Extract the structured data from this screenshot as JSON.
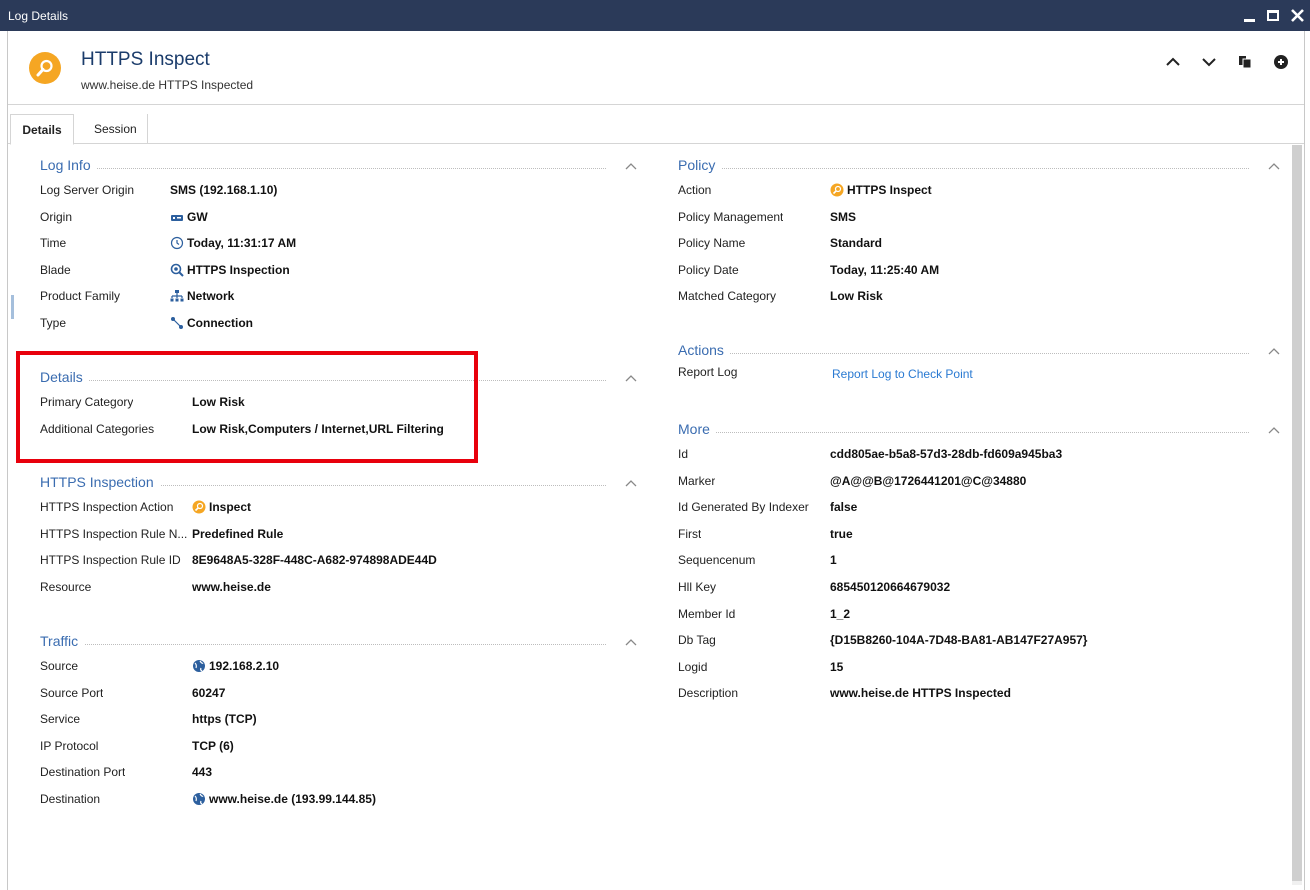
{
  "window": {
    "title": "Log Details"
  },
  "header": {
    "title": "HTTPS Inspect",
    "subtitle": "www.heise.de HTTPS Inspected"
  },
  "tabs": [
    {
      "label": "Details"
    },
    {
      "label": "Session"
    }
  ],
  "left": {
    "log_info": {
      "title": "Log Info",
      "rows": [
        {
          "label": "Log Server Origin",
          "value": "SMS (192.168.1.10)"
        },
        {
          "label": "Origin",
          "value": "GW",
          "icon": "gateway-icon"
        },
        {
          "label": "Time",
          "value": "Today, 11:31:17 AM",
          "icon": "clock-icon"
        },
        {
          "label": "Blade",
          "value": "HTTPS Inspection",
          "icon": "https-inspection-icon"
        },
        {
          "label": "Product Family",
          "value": "Network",
          "icon": "network-icon"
        },
        {
          "label": "Type",
          "value": "Connection",
          "icon": "connection-icon"
        }
      ]
    },
    "details": {
      "title": "Details",
      "rows": [
        {
          "label": "Primary Category",
          "value": "Low Risk"
        },
        {
          "label": "Additional Categories",
          "value": "Low Risk,Computers / Internet,URL Filtering"
        }
      ]
    },
    "https_inspection": {
      "title": "HTTPS Inspection",
      "rows": [
        {
          "label": "HTTPS Inspection Action",
          "value": "Inspect",
          "icon": "inspect-icon"
        },
        {
          "label": "HTTPS Inspection Rule N...",
          "value": "Predefined Rule"
        },
        {
          "label": "HTTPS Inspection Rule ID",
          "value": "8E9648A5-328F-448C-A682-974898ADE44D"
        },
        {
          "label": "Resource",
          "value": "www.heise.de"
        }
      ]
    },
    "traffic": {
      "title": "Traffic",
      "rows": [
        {
          "label": "Source",
          "value": "192.168.2.10",
          "icon": "globe-icon"
        },
        {
          "label": "Source Port",
          "value": "60247"
        },
        {
          "label": "Service",
          "value": "https (TCP)"
        },
        {
          "label": "IP Protocol",
          "value": "TCP (6)"
        },
        {
          "label": "Destination Port",
          "value": "443"
        },
        {
          "label": "Destination",
          "value": "www.heise.de (193.99.144.85)",
          "icon": "globe-icon"
        }
      ]
    }
  },
  "right": {
    "policy": {
      "title": "Policy",
      "rows": [
        {
          "label": "Action",
          "value": "HTTPS Inspect",
          "icon": "inspect-icon"
        },
        {
          "label": "Policy Management",
          "value": "SMS"
        },
        {
          "label": "Policy Name",
          "value": "Standard"
        },
        {
          "label": "Policy Date",
          "value": "Today, 11:25:40 AM"
        },
        {
          "label": "Matched Category",
          "value": "Low Risk"
        }
      ]
    },
    "actions": {
      "title": "Actions",
      "rows": [
        {
          "label": "Report Log",
          "value": "Report Log to Check Point"
        }
      ]
    },
    "more": {
      "title": "More",
      "rows": [
        {
          "label": "Id",
          "value": "cdd805ae-b5a8-57d3-28db-fd609a945ba3"
        },
        {
          "label": "Marker",
          "value": "@A@@B@1726441201@C@34880"
        },
        {
          "label": "Id Generated By Indexer",
          "value": "false"
        },
        {
          "label": "First",
          "value": "true"
        },
        {
          "label": "Sequencenum",
          "value": "1"
        },
        {
          "label": "Hll Key",
          "value": "685450120664679032"
        },
        {
          "label": "Member Id",
          "value": "1_2"
        },
        {
          "label": "Db Tag",
          "value": "{D15B8260-104A-7D48-BA81-AB147F27A957}"
        },
        {
          "label": "Logid",
          "value": "15"
        },
        {
          "label": "Description",
          "value": "www.heise.de HTTPS Inspected"
        }
      ]
    }
  },
  "colors": {
    "titlebar": "#2b3a59",
    "section_title": "#3a6cb0",
    "accent_orange": "#f5a623",
    "highlight": "#e8000c",
    "link": "#2a7ad2"
  }
}
